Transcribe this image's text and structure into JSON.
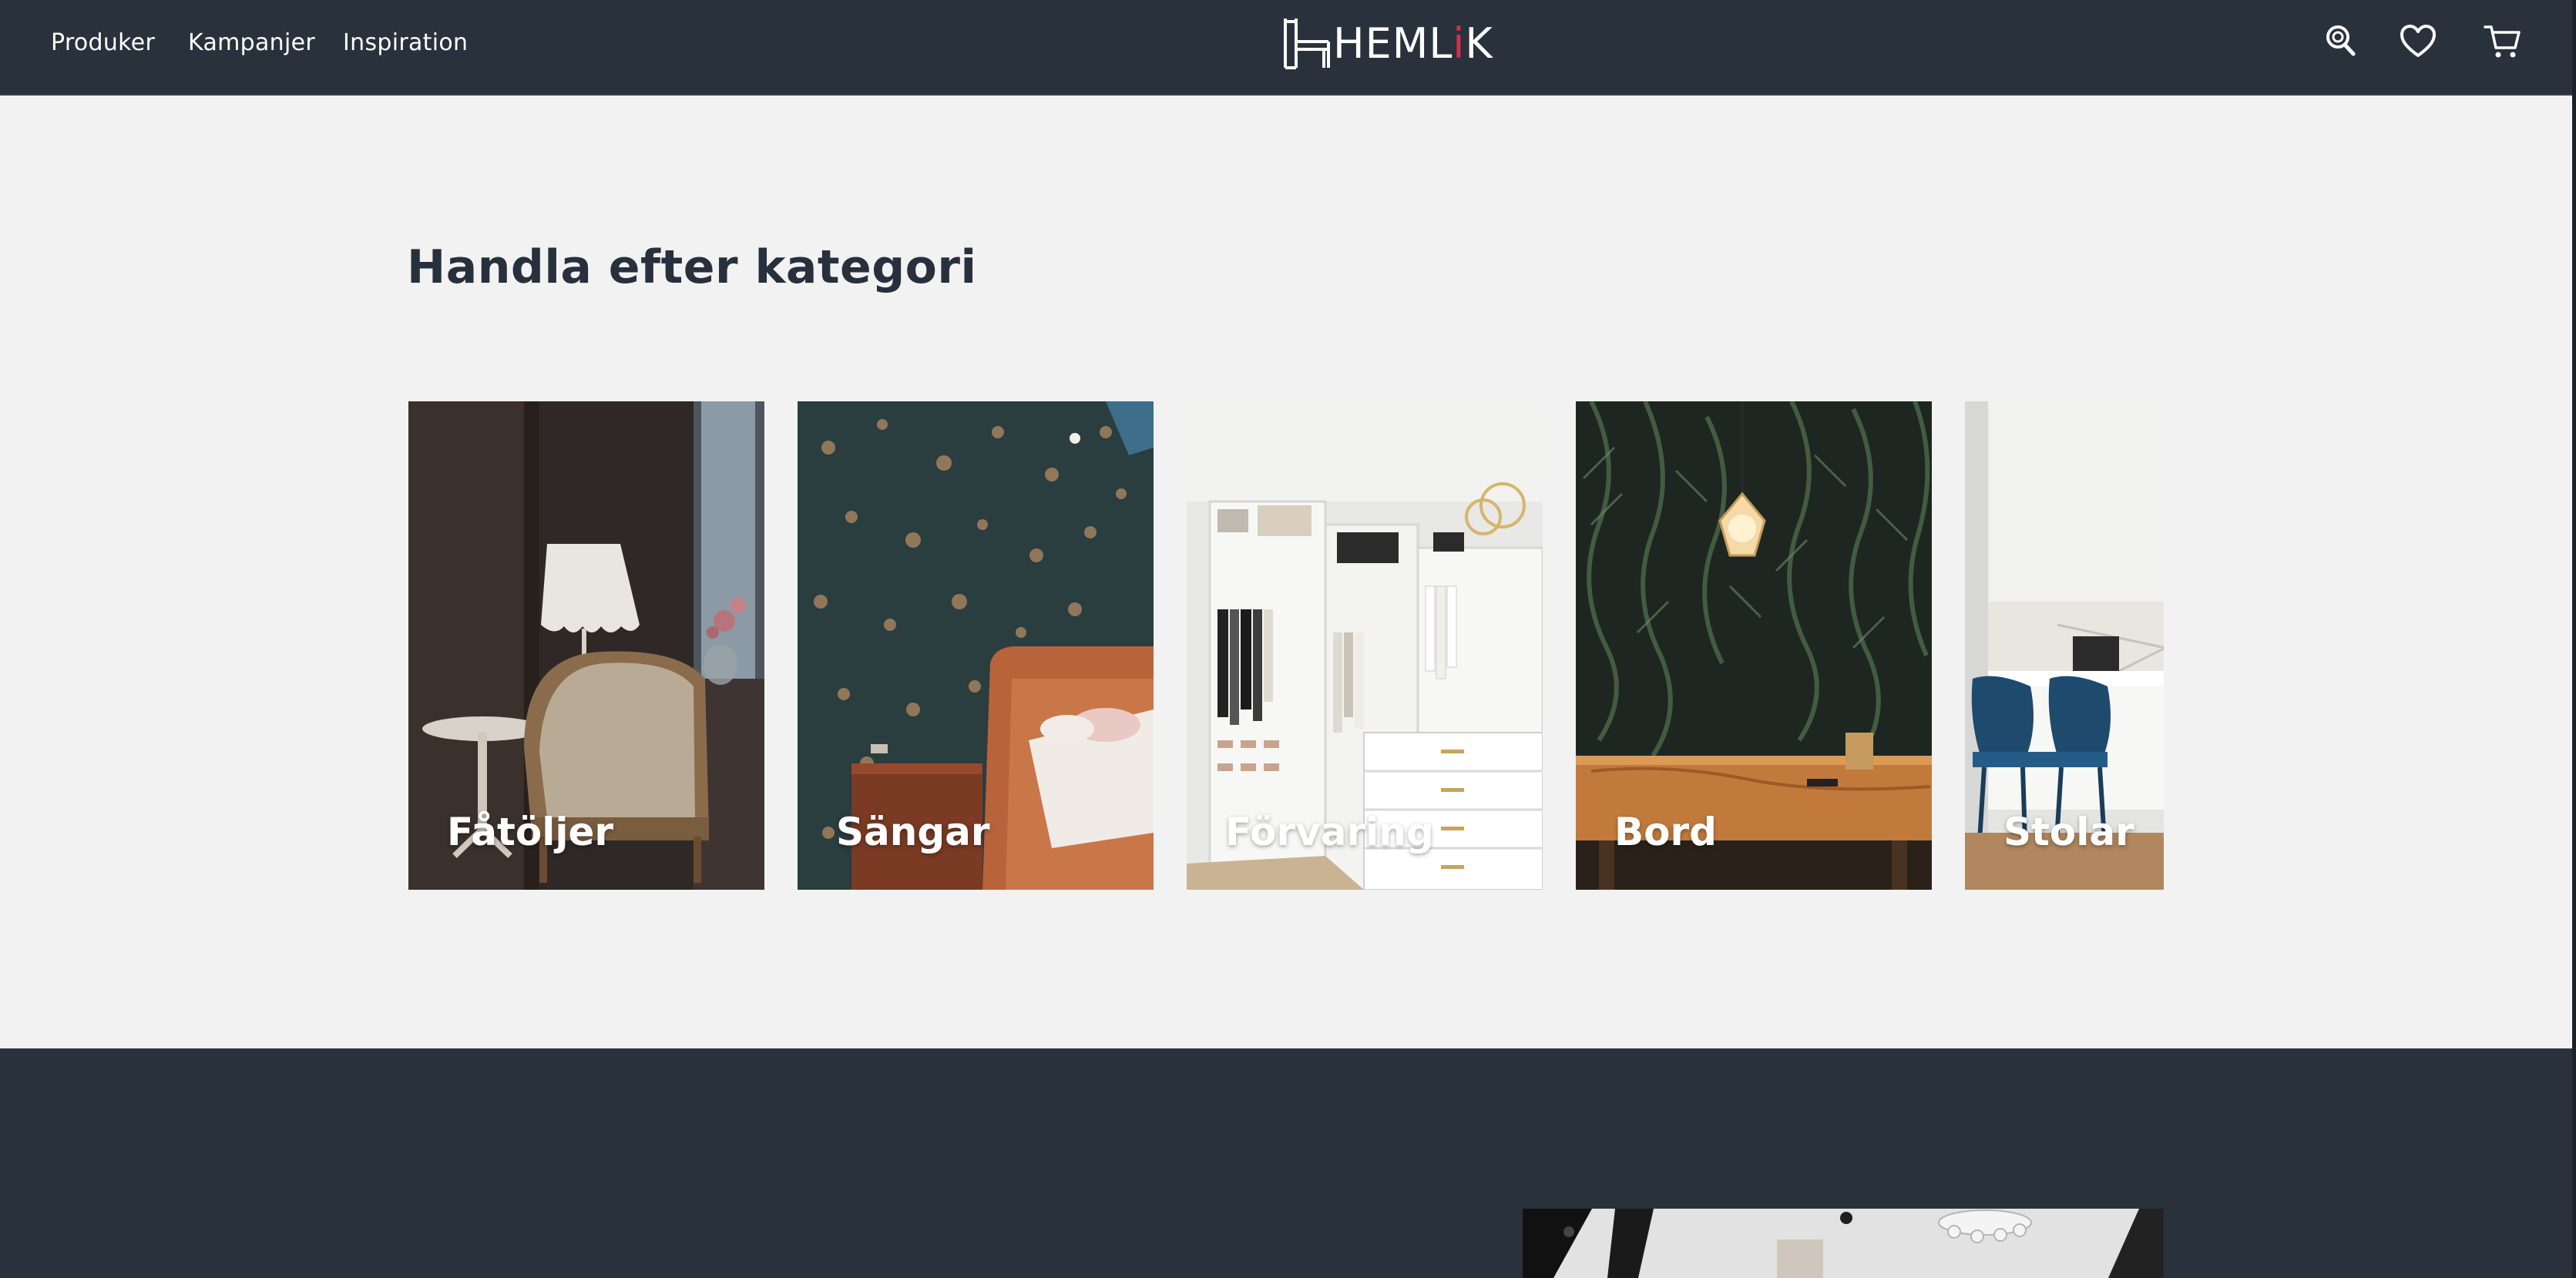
{
  "nav": {
    "links": [
      "Produker",
      "Kampanjer",
      "Inspiration"
    ]
  },
  "brand": {
    "name_prefix": "HEML",
    "name_i": "i",
    "name_suffix": "K",
    "accent": "#d6304a"
  },
  "header_icons": [
    "search-icon",
    "heart-icon",
    "cart-icon"
  ],
  "colors": {
    "header_bg": "#29313c",
    "page_bg": "#f2f2f2",
    "title": "#27303c"
  },
  "categories_section": {
    "title": "Handla efter kategori",
    "cards": [
      {
        "label": "Fåtöljer"
      },
      {
        "label": "Sängar"
      },
      {
        "label": "Förvaring"
      },
      {
        "label": "Bord"
      },
      {
        "label": "Stolar"
      }
    ]
  }
}
